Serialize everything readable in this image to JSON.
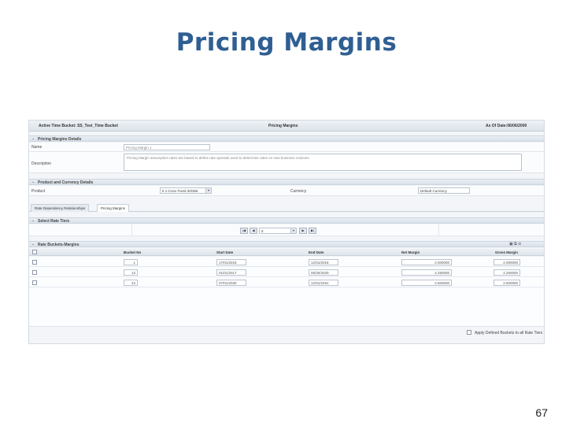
{
  "slide": {
    "title": "Pricing Margins",
    "page_number": "67"
  },
  "topbar": {
    "active_label": "Active Time Bucket:",
    "active_value": "SS_Test_Time Bucket",
    "center_title": "Pricing Margins",
    "as_of_label": "As Of Date:",
    "as_of_value": "06/06/2000"
  },
  "sections": {
    "details": "Pricing Margins Details",
    "product_currency": "Product and Currency Details",
    "rate_tiers": "Select Rate Tiers",
    "buckets": "Rate Buckets-Margins"
  },
  "details": {
    "name_label": "Name",
    "name_value": "Pricing Margin 1",
    "description_label": "Description",
    "description_value": "Pricing Margin assumption rates are based to define rate spreads used to determine rates on new business volumes."
  },
  "product": {
    "product_label": "Product",
    "product_value": "5 1-Conv Fixed 30/365",
    "currency_label": "Currency",
    "currency_value": "Default Currency"
  },
  "tabs": [
    {
      "label": "Rate Dependency Relationships"
    },
    {
      "label": "Pricing Margins"
    }
  ],
  "pager": {
    "first": "|◀",
    "prev": "◀",
    "value": "5",
    "next": "▶",
    "last": "▶|"
  },
  "grid": {
    "headers": {
      "bucket_no": "Bucket No",
      "start_date": "Start Date",
      "end_date": "End Date",
      "net_margin": "Net Margin",
      "gross_margin": "Gross Margin"
    },
    "rows": [
      {
        "bucket_no": "1",
        "start_date": "17/01/2018",
        "end_date": "12/31/2018",
        "net_margin": "2.000000",
        "gross_margin": "2.000000"
      },
      {
        "bucket_no": "13",
        "start_date": "01/01/2017",
        "end_date": "06/30/2030",
        "net_margin": "2.250000",
        "gross_margin": "2.250000"
      },
      {
        "bucket_no": "24",
        "start_date": "07/01/2030",
        "end_date": "12/31/2491",
        "net_margin": "2.500000",
        "gross_margin": "2.500000"
      }
    ]
  },
  "apply_all_label": "Apply Defined Buckets to all Rate Tiers",
  "icons": {
    "section_toggle": "chevron-down-icon",
    "toolbar": [
      "add-icon",
      "copy-icon",
      "delete-icon"
    ],
    "dropdown": "chevron-down-icon"
  },
  "colors": {
    "title": "#2f5f92",
    "as_of_date": "#1f8a1f"
  }
}
